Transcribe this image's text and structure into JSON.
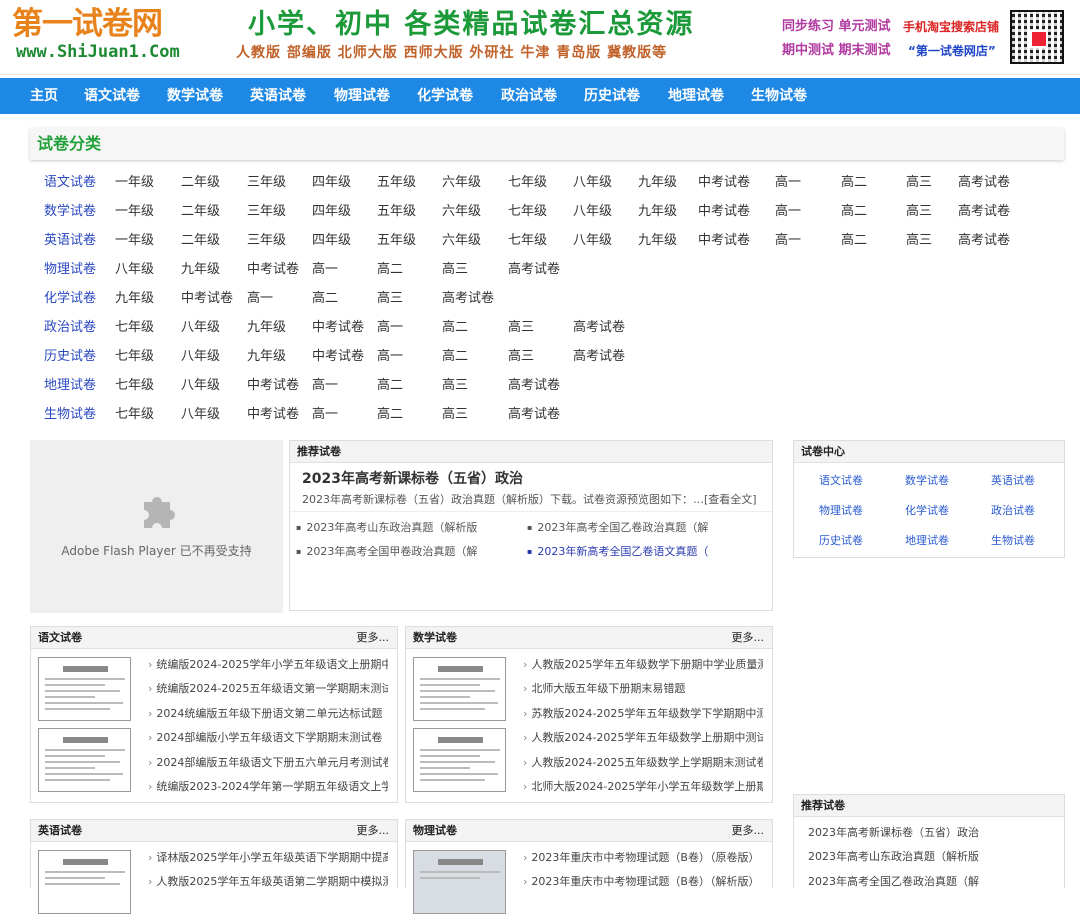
{
  "header": {
    "logo_text": "第一试卷网",
    "logo_url": "www.ShiJuan1.Com",
    "banner_main": "小学、初中 各类精品试卷汇总资源",
    "banner_editions": "人教版 部编版 北师大版 西师大版 外研社 牛津 青岛版  冀教版等",
    "promo_sync": "同步练习 单元测试",
    "promo_shop": "手机淘宝搜索店铺",
    "promo_exams": "期中测试 期末测试",
    "promo_store": "“第一试卷网店”"
  },
  "nav": {
    "items": [
      "主页",
      "语文试卷",
      "数学试卷",
      "英语试卷",
      "物理试卷",
      "化学试卷",
      "政治试卷",
      "历史试卷",
      "地理试卷",
      "生物试卷"
    ]
  },
  "categories": {
    "title": "试卷分类",
    "rows": [
      [
        "语文试卷",
        "一年级",
        "二年级",
        "三年级",
        "四年级",
        "五年级",
        "六年级",
        "七年级",
        "八年级",
        "九年级",
        "中考试卷",
        "高一",
        "高二",
        "高三",
        "高考试卷"
      ],
      [
        "数学试卷",
        "一年级",
        "二年级",
        "三年级",
        "四年级",
        "五年级",
        "六年级",
        "七年级",
        "八年级",
        "九年级",
        "中考试卷",
        "高一",
        "高二",
        "高三",
        "高考试卷"
      ],
      [
        "英语试卷",
        "一年级",
        "二年级",
        "三年级",
        "四年级",
        "五年级",
        "六年级",
        "七年级",
        "八年级",
        "九年级",
        "中考试卷",
        "高一",
        "高二",
        "高三",
        "高考试卷"
      ],
      [
        "物理试卷",
        "八年级",
        "九年级",
        "中考试卷",
        "高一",
        "高二",
        "高三",
        "高考试卷"
      ],
      [
        "化学试卷",
        "九年级",
        "中考试卷",
        "高一",
        "高二",
        "高三",
        "高考试卷"
      ],
      [
        "政治试卷",
        "七年级",
        "八年级",
        "九年级",
        "中考试卷",
        "高一",
        "高二",
        "高三",
        "高考试卷"
      ],
      [
        "历史试卷",
        "七年级",
        "八年级",
        "九年级",
        "中考试卷",
        "高一",
        "高二",
        "高三",
        "高考试卷"
      ],
      [
        "地理试卷",
        "七年级",
        "八年级",
        "中考试卷",
        "高一",
        "高二",
        "高三",
        "高考试卷"
      ],
      [
        "生物试卷",
        "七年级",
        "八年级",
        "中考试卷",
        "高一",
        "高二",
        "高三",
        "高考试卷"
      ]
    ]
  },
  "flash": {
    "icon": "puzzle-icon",
    "message": "Adobe Flash Player 已不再受支持"
  },
  "recommended": {
    "title": "推荐试卷",
    "headline": "2023年高考新课标卷（五省）政治",
    "summary": "2023年高考新课标卷（五省）政治真题（解析版）下载。试卷资源预览图如下：…[查看全文]",
    "list": [
      "2023年高考山东政治真题（解析版",
      "2023年高考全国乙卷政治真题（解",
      "2023年高考全国甲卷政治真题（解",
      "2023年新高考全国乙卷语文真题（"
    ]
  },
  "center": {
    "title": "试卷中心",
    "items": [
      "语文试卷",
      "数学试卷",
      "英语试卷",
      "物理试卷",
      "化学试卷",
      "政治试卷",
      "历史试卷",
      "地理试卷",
      "生物试卷"
    ]
  },
  "sections": [
    {
      "title": "语文试卷",
      "more": "更多...",
      "items": [
        "统编版2024-2025学年小学五年级语文上册期中",
        "统编版2024-2025五年级语文第一学期期末测试",
        "2024统编版五年级下册语文第二单元达标试题",
        "2024部编版小学五年级语文下学期期末测试卷",
        "2024部编版五年级语文下册五六单元月考测试卷",
        "统编版2023-2024学年第一学期五年级语文上学"
      ]
    },
    {
      "title": "数学试卷",
      "more": "更多...",
      "items": [
        "人教版2025学年五年级数学下册期中学业质量测",
        "北师大版五年级下册期末易错题",
        "苏教版2024-2025学年五年级数学下学期期中测",
        "人教版2024-2025学年五年级数学上册期中测试",
        "人教版2024-2025五年级数学上学期期末测试卷",
        "北师大版2024-2025学年小学五年级数学上册期"
      ]
    },
    {
      "title": "英语试卷",
      "more": "更多...",
      "items": [
        "译林版2025学年小学五年级英语下学期期中提高",
        "人教版2025学年五年级英语第二学期期中模拟测"
      ]
    },
    {
      "title": "物理试卷",
      "more": "更多...",
      "items": [
        "2023年重庆市中考物理试题（B卷）（原卷版）",
        "2023年重庆市中考物理试题（B卷）（解析版）"
      ]
    }
  ],
  "recommended_side": {
    "title": "推荐试卷",
    "items": [
      "2023年高考新课标卷（五省）政治",
      "2023年高考山东政治真题（解析版",
      "2023年高考全国乙卷政治真题（解"
    ]
  },
  "colors": {
    "nav_bg": "#1e88e5",
    "category_title": "#23a13a",
    "category_first": "#2a48c0",
    "logo_orange": "#e8821a",
    "logo_green": "#1d8a33"
  }
}
